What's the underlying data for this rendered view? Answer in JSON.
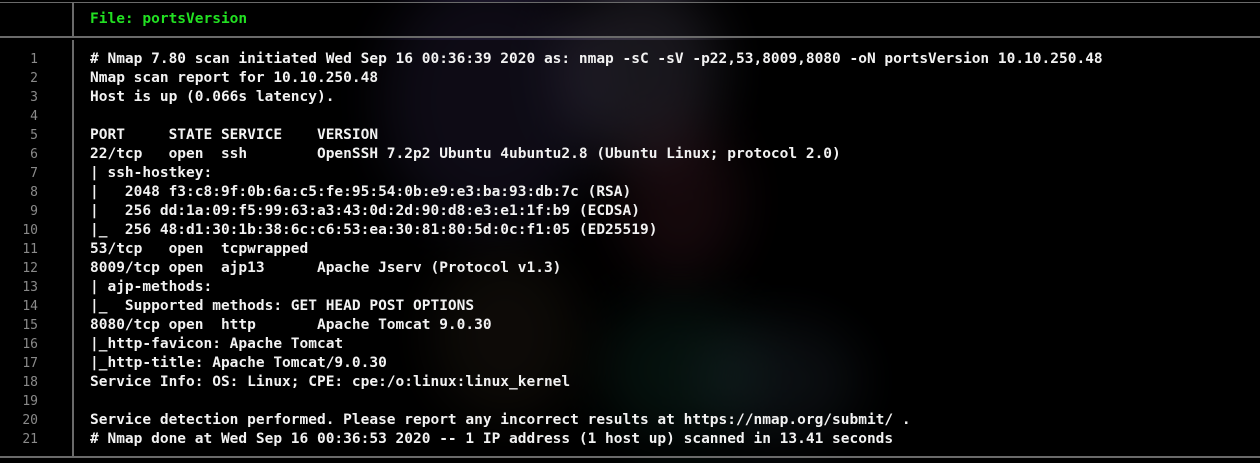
{
  "header": {
    "title": "File: portsVersion"
  },
  "lines": [
    {
      "num": "1",
      "text": "# Nmap 7.80 scan initiated Wed Sep 16 00:36:39 2020 as: nmap -sC -sV -p22,53,8009,8080 -oN portsVersion 10.10.250.48"
    },
    {
      "num": "2",
      "text": "Nmap scan report for 10.10.250.48"
    },
    {
      "num": "3",
      "text": "Host is up (0.066s latency)."
    },
    {
      "num": "4",
      "text": ""
    },
    {
      "num": "5",
      "text": "PORT     STATE SERVICE    VERSION"
    },
    {
      "num": "6",
      "text": "22/tcp   open  ssh        OpenSSH 7.2p2 Ubuntu 4ubuntu2.8 (Ubuntu Linux; protocol 2.0)"
    },
    {
      "num": "7",
      "text": "| ssh-hostkey:"
    },
    {
      "num": "8",
      "text": "|   2048 f3:c8:9f:0b:6a:c5:fe:95:54:0b:e9:e3:ba:93:db:7c (RSA)"
    },
    {
      "num": "9",
      "text": "|   256 dd:1a:09:f5:99:63:a3:43:0d:2d:90:d8:e3:e1:1f:b9 (ECDSA)"
    },
    {
      "num": "10",
      "text": "|_  256 48:d1:30:1b:38:6c:c6:53:ea:30:81:80:5d:0c:f1:05 (ED25519)"
    },
    {
      "num": "11",
      "text": "53/tcp   open  tcpwrapped"
    },
    {
      "num": "12",
      "text": "8009/tcp open  ajp13      Apache Jserv (Protocol v1.3)"
    },
    {
      "num": "13",
      "text": "| ajp-methods:"
    },
    {
      "num": "14",
      "text": "|_  Supported methods: GET HEAD POST OPTIONS"
    },
    {
      "num": "15",
      "text": "8080/tcp open  http       Apache Tomcat 9.0.30"
    },
    {
      "num": "16",
      "text": "|_http-favicon: Apache Tomcat"
    },
    {
      "num": "17",
      "text": "|_http-title: Apache Tomcat/9.0.30"
    },
    {
      "num": "18",
      "text": "Service Info: OS: Linux; CPE: cpe:/o:linux:linux_kernel"
    },
    {
      "num": "19",
      "text": ""
    },
    {
      "num": "20",
      "text": "Service detection performed. Please report any incorrect results at https://nmap.org/submit/ ."
    },
    {
      "num": "21",
      "text": "# Nmap done at Wed Sep 16 00:36:53 2020 -- 1 IP address (1 host up) scanned in 13.41 seconds"
    }
  ],
  "colors": {
    "title": "#22e022",
    "text": "#f2f2f2",
    "line_number": "#8a8a8a",
    "border": "#6a6a6a",
    "background": "#000000"
  }
}
